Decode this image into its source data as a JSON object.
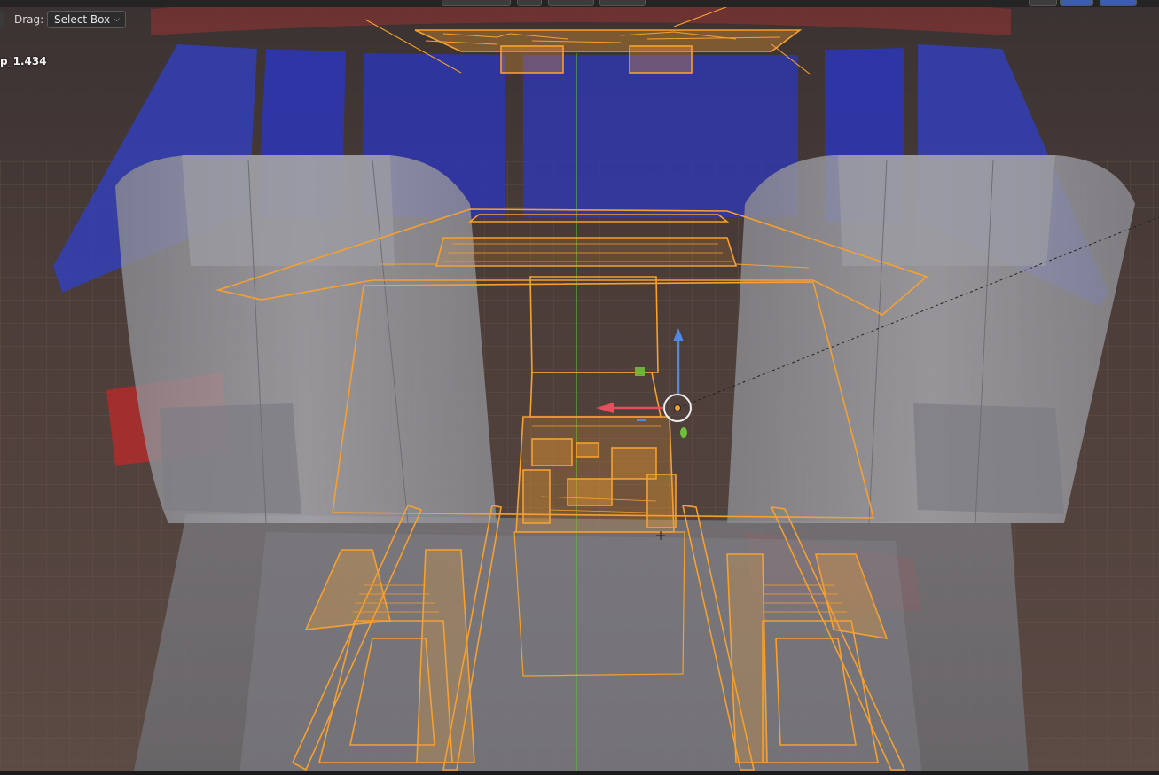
{
  "header": {
    "drag_label": "Drag:",
    "select_mode": "Select Box"
  },
  "active_object": {
    "name": "p_1.434"
  },
  "colors": {
    "selection": "#f5a030",
    "axis_x": "#e84d5b",
    "axis_y": "#6fbf3a",
    "axis_z": "#4d8ae8",
    "seat_blue": "#2f3bd0",
    "seat_red": "#c02a2a",
    "grid_floor": "#5a4740"
  },
  "icons": {
    "dropdown": "chevron-down-icon",
    "gizmo": "transform-gizmo-icon"
  }
}
